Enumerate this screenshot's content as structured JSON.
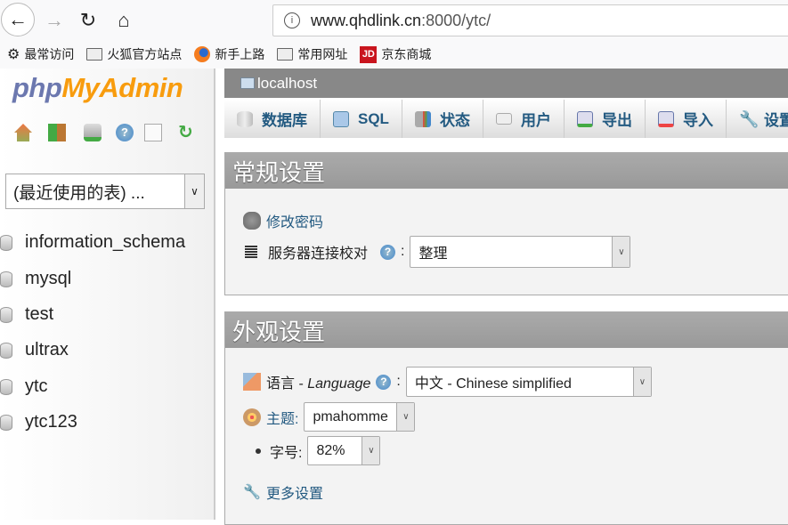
{
  "browser": {
    "url_host": "www.qhdlink.cn",
    "url_rest": ":8000/ytc/",
    "bookmarks": [
      {
        "label": "最常访问",
        "icon": "gear-icon"
      },
      {
        "label": "火狐官方站点",
        "icon": "folder-icon"
      },
      {
        "label": "新手上路",
        "icon": "firefox-icon"
      },
      {
        "label": "常用网址",
        "icon": "folder-icon"
      },
      {
        "label": "京东商城",
        "icon": "jd-icon",
        "icon_text": "JD"
      }
    ]
  },
  "sidebar": {
    "logo_a": "php",
    "logo_b": "MyAdmin",
    "recent": "(最近使用的表) ...",
    "databases": [
      "information_schema",
      "mysql",
      "test",
      "ultrax",
      "ytc",
      "ytc123"
    ]
  },
  "server": "localhost",
  "tabs": [
    {
      "label": "数据库",
      "icon": "database-icon"
    },
    {
      "label": "SQL",
      "icon": "sql-icon"
    },
    {
      "label": "状态",
      "icon": "status-icon"
    },
    {
      "label": "用户",
      "icon": "users-icon"
    },
    {
      "label": "导出",
      "icon": "export-icon"
    },
    {
      "label": "导入",
      "icon": "import-icon"
    },
    {
      "label": "设置",
      "icon": "wrench-icon"
    }
  ],
  "general": {
    "title": "常规设置",
    "change_password": "修改密码",
    "collation_label": "服务器连接校对",
    "collation_value": "整理"
  },
  "appearance": {
    "title": "外观设置",
    "language_label": "语言 - ",
    "language_italic": "Language",
    "language_value": "中文 - Chinese simplified",
    "theme_label": "主题:",
    "theme_value": "pmahomme",
    "font_label": "字号:",
    "font_value": "82%",
    "more": "更多设置"
  },
  "colors": {
    "link": "#235a81",
    "header": "#999999",
    "logo_php": "#6c78af",
    "logo_myadmin": "#f89c0e"
  }
}
